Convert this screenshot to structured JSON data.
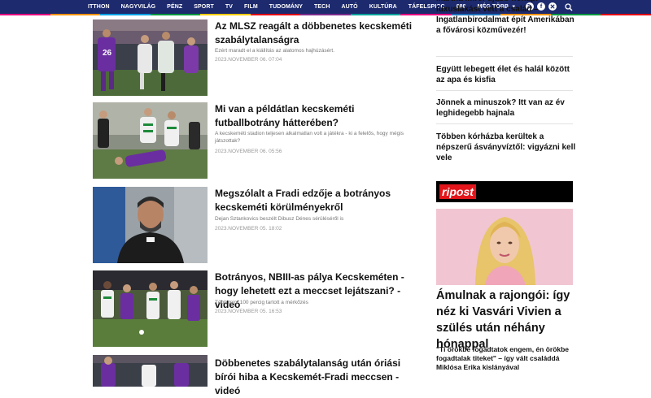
{
  "nav": {
    "items": [
      {
        "label": "ITTHON"
      },
      {
        "label": "NAGYVILÁG"
      },
      {
        "label": "PÉNZ"
      },
      {
        "label": "SPORT"
      },
      {
        "label": "TV"
      },
      {
        "label": "FILM"
      },
      {
        "label": "TUDOMÁNY"
      },
      {
        "label": "TECH"
      },
      {
        "label": "AUTÓ"
      },
      {
        "label": "KULTÚRA"
      },
      {
        "label": "TÁFELSPICC"
      },
      {
        "label": "888"
      },
      {
        "label": "MÉG TÖBB"
      }
    ],
    "stripe_colors": [
      "#e6007e",
      "#f39200",
      "#00a0e3",
      "#009640",
      "#ffcc00",
      "#e30613",
      "#7b2c8b",
      "#00a19a",
      "#e6007e",
      "#1d71b8",
      "#f39200",
      "#009640",
      "#e30613"
    ],
    "icons": [
      "rss-icon",
      "facebook-icon",
      "x-icon",
      "search-icon"
    ]
  },
  "articles": [
    {
      "title": "Az MLSZ reagált a döbbenetes kecskeméti szabálytalanságra",
      "lead": "Ezért maradt el a kiállítás az alatomos hajhúzásért.",
      "date": "2023.NOVEMBER 06. 07:04"
    },
    {
      "title": "Mi van a példátlan kecskeméti futballbotrány hátterében?",
      "lead": "A kecskeméti stadion teljesen alkalmatlan volt a játékra - ki a felelős, hogy mégis játszottak?",
      "date": "2023.NOVEMBER 06. 05:56"
    },
    {
      "title": "Megszólalt a Fradi edzője a botrányos kecskeméti körülményekről",
      "lead": "Dejan Sztankovics beszélt Dibusz Dénes sérüléséről is",
      "date": "2023.NOVEMBER 05. 18:02"
    },
    {
      "title": "Botrányos, NBIII-as pálya Kecskeméten - hogy lehetett ezt a meccset lejátszani? - videó",
      "lead": "Több mint 100 percig tartott a mérkőzés",
      "date": "2023.NOVEMBER 05. 16:53"
    },
    {
      "title": "Döbbenetes szabálytalanság után óriási bírói hiba a Kecskemét-Fradi meccsen - videó",
      "lead": "",
      "date": ""
    }
  ],
  "sidebar": {
    "items": [
      {
        "text": "Mártha Imre: újabb hónapi luxuslakást vett a család – Ingatlanbirodalmat épít Amerikában a fővárosi közművezér!"
      },
      {
        "text": "Együtt lebegett élet és halál között az apa és kisfia"
      },
      {
        "text": "Jönnek a minuszok? Itt van az év leghidegebb hajnala"
      },
      {
        "text": "Többen kórházba kerültek a népszerű ásványvíztől: vigyázni kell vele"
      }
    ],
    "ripost": {
      "logo": "ripost",
      "headline": "Ámulnak a rajongói: így néz ki Vasvári Vivien a szülés után néhány hónappal",
      "subheadline": "\"Ti örökbe fogadtatok engem, én örökbe fogadtalak titeket\" – így vált családdá Miklósa Erika kislányával"
    }
  }
}
